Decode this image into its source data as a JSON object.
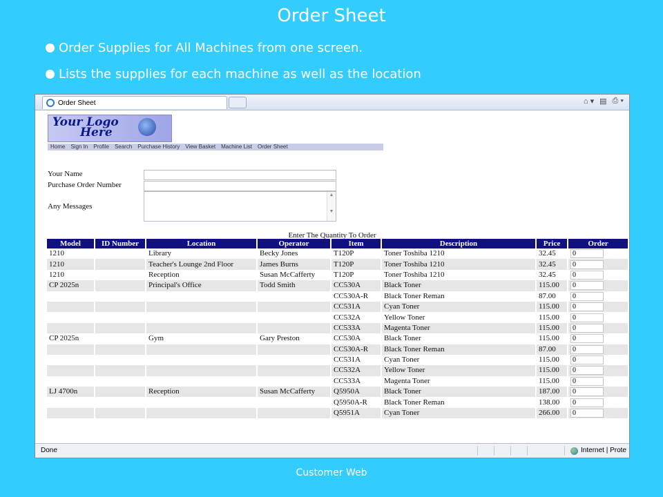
{
  "slide": {
    "title": "Order Sheet",
    "bullets": [
      "Order Supplies for All Machines from one screen.",
      "Lists the supplies for each machine as well as the location"
    ],
    "footer": "Customer Web"
  },
  "browser": {
    "tab_title": "Order Sheet",
    "status_left": "Done",
    "status_zone": "Internet | Prote"
  },
  "site": {
    "logo_line1": "Your Logo",
    "logo_line2": "Here",
    "nav": [
      "Home",
      "Sign In",
      "Profile",
      "Search",
      "Purchase History",
      "View Basket",
      "Machine List",
      "Order Sheet"
    ]
  },
  "form": {
    "name_label": "Your Name",
    "po_label": "Purchase Order Number",
    "msg_label": "Any Messages"
  },
  "table": {
    "caption": "Enter The Quantity To Order",
    "headers": [
      "Model",
      "ID Number",
      "Location",
      "Operator",
      "Item",
      "Description",
      "Price",
      "Order"
    ],
    "rows": [
      {
        "model": "1210",
        "id": "",
        "location": "Library",
        "operator": "Becky Jones",
        "item": "T120P",
        "description": "Toner Toshiba 1210",
        "price": "32.45",
        "order": "0"
      },
      {
        "model": "1210",
        "id": "",
        "location": "Teacher's Lounge 2nd Floor",
        "operator": "James Burns",
        "item": "T120P",
        "description": "Toner Toshiba 1210",
        "price": "32.45",
        "order": "0"
      },
      {
        "model": "1210",
        "id": "",
        "location": "Reception",
        "operator": "Susan McCafferty",
        "item": "T120P",
        "description": "Toner Toshiba 1210",
        "price": "32.45",
        "order": "0"
      },
      {
        "model": "CP 2025n",
        "id": "",
        "location": "Principal's Office",
        "operator": "Todd Smith",
        "item": "CC530A",
        "description": "Black Toner",
        "price": "115.00",
        "order": "0"
      },
      {
        "model": "",
        "id": "",
        "location": "",
        "operator": "",
        "item": "CC530A-R",
        "description": "Black Toner Reman",
        "price": "87.00",
        "order": "0"
      },
      {
        "model": "",
        "id": "",
        "location": "",
        "operator": "",
        "item": "CC531A",
        "description": "Cyan Toner",
        "price": "115.00",
        "order": "0"
      },
      {
        "model": "",
        "id": "",
        "location": "",
        "operator": "",
        "item": "CC532A",
        "description": "Yellow Toner",
        "price": "115.00",
        "order": "0"
      },
      {
        "model": "",
        "id": "",
        "location": "",
        "operator": "",
        "item": "CC533A",
        "description": "Magenta Toner",
        "price": "115.00",
        "order": "0"
      },
      {
        "model": "CP 2025n",
        "id": "",
        "location": "Gym",
        "operator": "Gary Preston",
        "item": "CC530A",
        "description": "Black Toner",
        "price": "115.00",
        "order": "0"
      },
      {
        "model": "",
        "id": "",
        "location": "",
        "operator": "",
        "item": "CC530A-R",
        "description": "Black Toner Reman",
        "price": "87.00",
        "order": "0"
      },
      {
        "model": "",
        "id": "",
        "location": "",
        "operator": "",
        "item": "CC531A",
        "description": "Cyan Toner",
        "price": "115.00",
        "order": "0"
      },
      {
        "model": "",
        "id": "",
        "location": "",
        "operator": "",
        "item": "CC532A",
        "description": "Yellow Toner",
        "price": "115.00",
        "order": "0"
      },
      {
        "model": "",
        "id": "",
        "location": "",
        "operator": "",
        "item": "CC533A",
        "description": "Magenta Toner",
        "price": "115.00",
        "order": "0"
      },
      {
        "model": "LJ 4700n",
        "id": "",
        "location": "Reception",
        "operator": "Susan McCafferty",
        "item": "Q5950A",
        "description": "Black Toner",
        "price": "187.00",
        "order": "0"
      },
      {
        "model": "",
        "id": "",
        "location": "",
        "operator": "",
        "item": "Q5950A-R",
        "description": "Black Toner Reman",
        "price": "138.00",
        "order": "0"
      },
      {
        "model": "",
        "id": "",
        "location": "",
        "operator": "",
        "item": "Q5951A",
        "description": "Cyan Toner",
        "price": "266.00",
        "order": "0"
      }
    ]
  },
  "colors": {
    "slide_bg": "#33ccff",
    "table_header": "#101080"
  }
}
